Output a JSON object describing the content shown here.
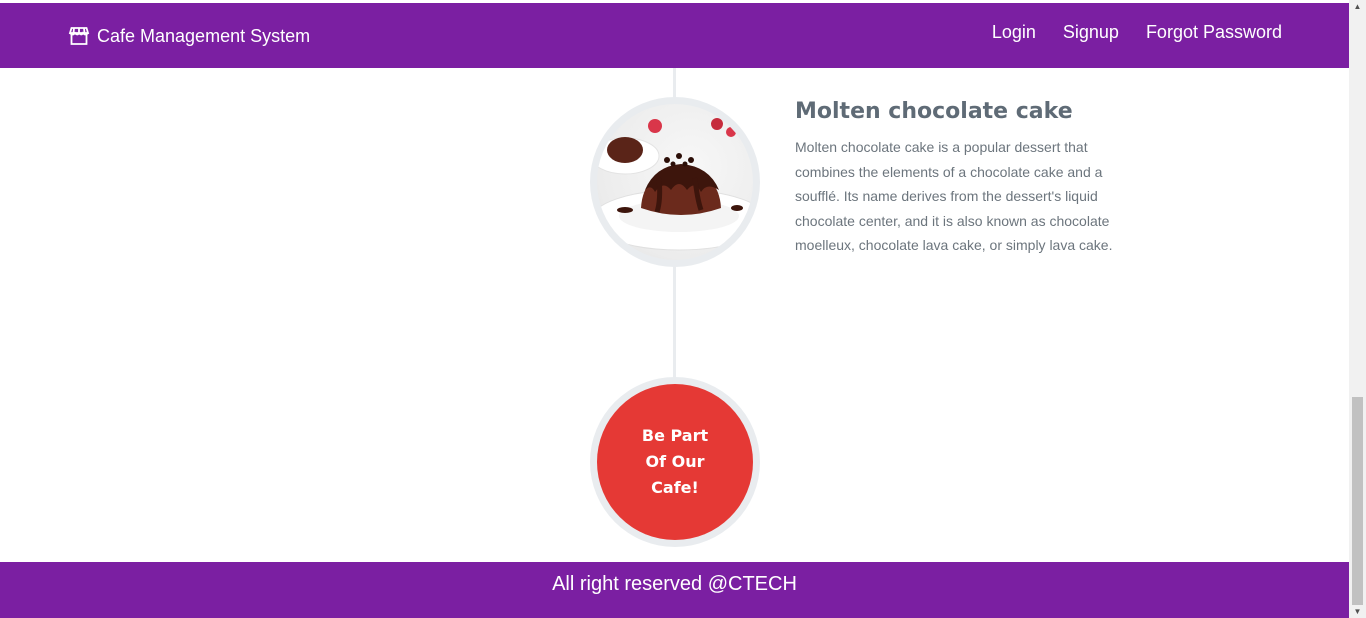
{
  "header": {
    "brand_icon": "store-icon",
    "brand_title": "Cafe Management System",
    "nav": [
      {
        "label": "Login"
      },
      {
        "label": "Signup"
      },
      {
        "label": "Forgot Password"
      }
    ]
  },
  "timeline": {
    "item": {
      "image_icon": "molten-chocolate-cake-image",
      "title": "Molten chocolate cake",
      "description": "Molten chocolate cake is a popular dessert that combines the elements of a chocolate cake and a soufflé. Its name derives from the dessert's liquid chocolate center, and it is also known as chocolate moelleux, chocolate lava cake, or simply lava cake."
    },
    "cta_lines": [
      "Be Part",
      "Of Our",
      "Cafe!"
    ]
  },
  "footer": {
    "text": "All right reserved @CTECH"
  },
  "colors": {
    "primary": "#7b1fa2",
    "cta": "#e53935",
    "timeline": "#e9ecef",
    "heading": "#5f6b76",
    "body_text": "#6c757d"
  }
}
